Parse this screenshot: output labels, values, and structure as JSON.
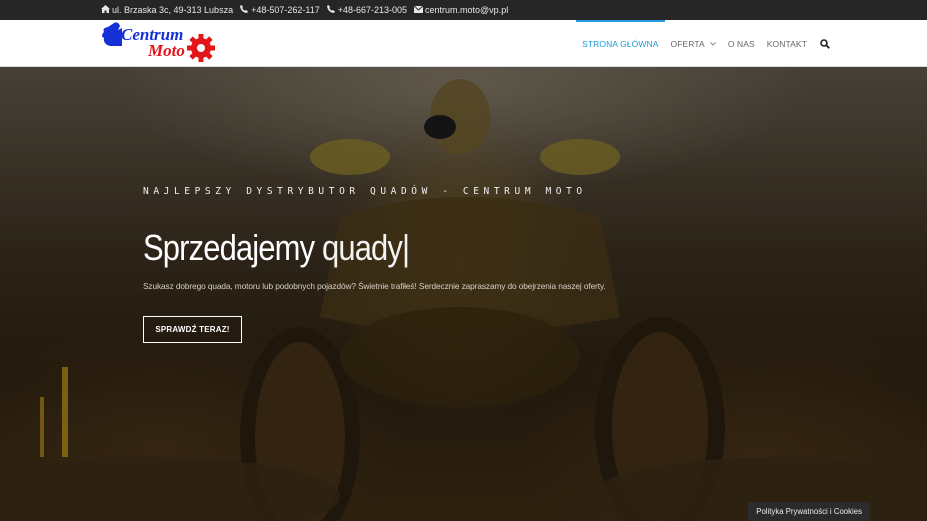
{
  "topbar": {
    "address": "ul. Brzaska 3c, 49-313 Lubsza",
    "phone1": "+48-507-262-117",
    "phone2": "+48-667-213-005",
    "email": "centrum.moto@vp.pl",
    "icons": [
      "home-icon",
      "phone-icon",
      "phone-icon",
      "envelope-icon"
    ]
  },
  "logo": {
    "line1": "Centrum",
    "line2": "Moto",
    "colors": {
      "blue": "#1630d8",
      "red": "#e2151b"
    }
  },
  "nav": {
    "items": [
      {
        "label": "STRONA GŁÓWNA",
        "active": true
      },
      {
        "label": "OFERTA",
        "dropdown": true
      },
      {
        "label": "O NAS"
      },
      {
        "label": "KONTAKT"
      }
    ],
    "accent": "#1e9bd8"
  },
  "hero": {
    "eyebrow": "NAJLEPSZY DYSTRYBUTOR QUADÓW - CENTRUM MOTO",
    "headline_bold": "Sprzedajemy",
    "headline_light": "quady|",
    "subtext": "Szukasz dobrego quada, motoru lub podobnych pojazdów? Świetnie trafiłeś! Serdecznie zapraszamy do obejrzenia naszej oferty.",
    "cta": "SPRAWDŹ TERAZ!"
  },
  "cookie": {
    "label": "Polityka Prywatności i Cookies"
  }
}
